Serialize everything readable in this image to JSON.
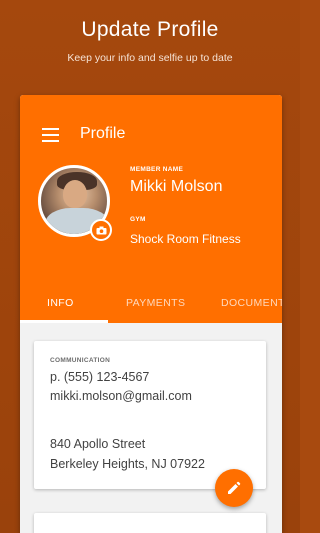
{
  "promo": {
    "headline": "Update Profile",
    "subhead": "Keep your info and selfie up to date"
  },
  "app": {
    "title": "Profile",
    "accent_color": "#ff6f00"
  },
  "profile": {
    "member_label": "MEMBER NAME",
    "member_name": "Mikki Molson",
    "gym_label": "GYM",
    "gym_name": "Shock Room Fitness"
  },
  "tabs": [
    {
      "label": "INFO",
      "active": true
    },
    {
      "label": "PAYMENTS",
      "active": false
    },
    {
      "label": "DOCUMENTS",
      "active": false
    }
  ],
  "communication": {
    "label": "COMMUNICATION",
    "phone": "p. (555) 123-4567",
    "email": "mikki.molson@gmail.com",
    "address_line1": "840 Apollo Street",
    "address_line2": "Berkeley Heights, NJ 07922"
  },
  "icons": {
    "menu": "menu-icon",
    "camera": "camera-icon",
    "edit": "pencil-icon"
  }
}
